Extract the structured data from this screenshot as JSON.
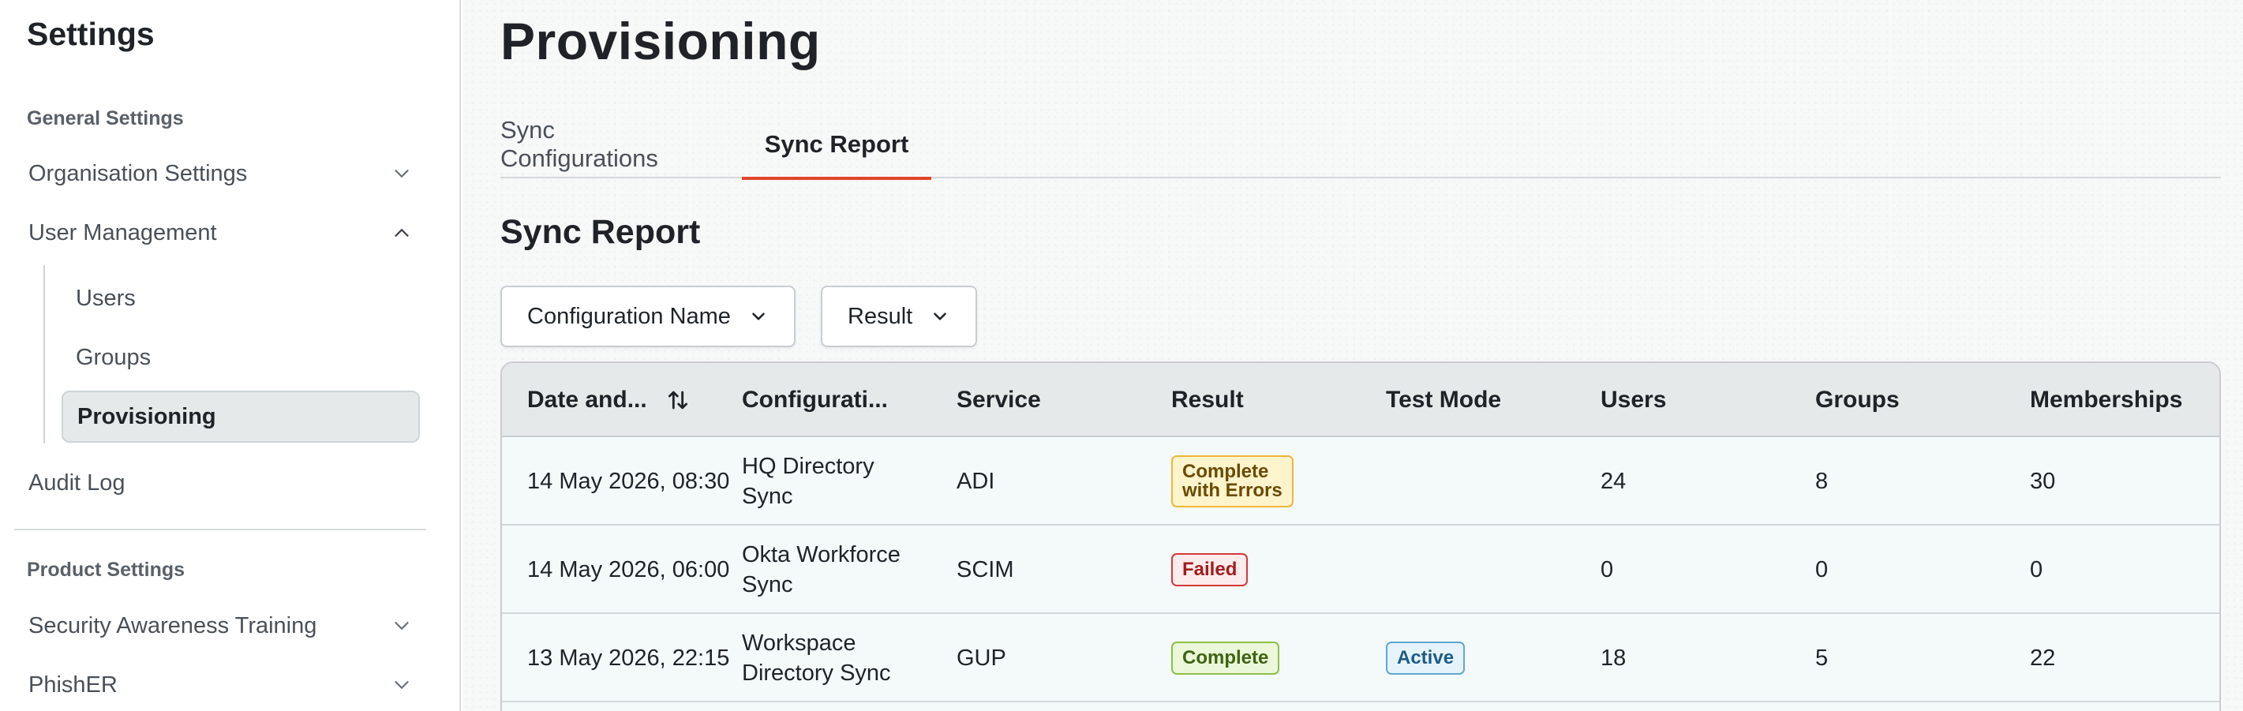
{
  "sidebar": {
    "title": "Settings",
    "general_section": "General Settings",
    "organisation_settings": "Organisation Settings",
    "user_management": "User Management",
    "users": "Users",
    "groups": "Groups",
    "provisioning": "Provisioning",
    "audit_log": "Audit Log",
    "product_section": "Product Settings",
    "security_awareness_training": "Security Awareness Training",
    "phisher": "PhishER"
  },
  "page": {
    "title": "Provisioning",
    "tabs": [
      "Sync Configurations",
      "Sync Report"
    ],
    "active_tab": "Sync Report",
    "section_heading": "Sync Report"
  },
  "filters": {
    "configuration_name": "Configuration Name",
    "result": "Result"
  },
  "table": {
    "headers": [
      "Date and...",
      "Configurati...",
      "Service",
      "Result",
      "Test Mode",
      "Users",
      "Groups",
      "Memberships"
    ],
    "rows": [
      {
        "date": "14 May 2026, 08:30",
        "config_line1": "HQ Directory",
        "config_line2": "Sync",
        "service": "ADI",
        "result_line1": "Complete",
        "result_line2": "with Errors",
        "result_status": "warning",
        "test_mode": "",
        "users": "24",
        "groups": "8",
        "memberships": "30"
      },
      {
        "date": "14 May 2026, 06:00",
        "config_line1": "Okta Workforce",
        "config_line2": "Sync",
        "service": "SCIM",
        "result_line1": "Failed",
        "result_line2": "",
        "result_status": "error",
        "test_mode": "",
        "users": "0",
        "groups": "0",
        "memberships": "0"
      },
      {
        "date": "13 May 2026, 22:15",
        "config_line1": "Workspace",
        "config_line2": "Directory Sync",
        "service": "GUP",
        "result_line1": "Complete",
        "result_line2": "",
        "result_status": "success",
        "test_mode": "Active",
        "users": "18",
        "groups": "5",
        "memberships": "22"
      }
    ]
  },
  "colors": {
    "accent": "#e0452a",
    "warning": "#f0b63c",
    "error": "#d33a3a",
    "success": "#8fbf4a",
    "info": "#5ea8d3"
  },
  "icons": [
    "chevron-down-icon",
    "chevron-up-icon",
    "sort-icon"
  ]
}
